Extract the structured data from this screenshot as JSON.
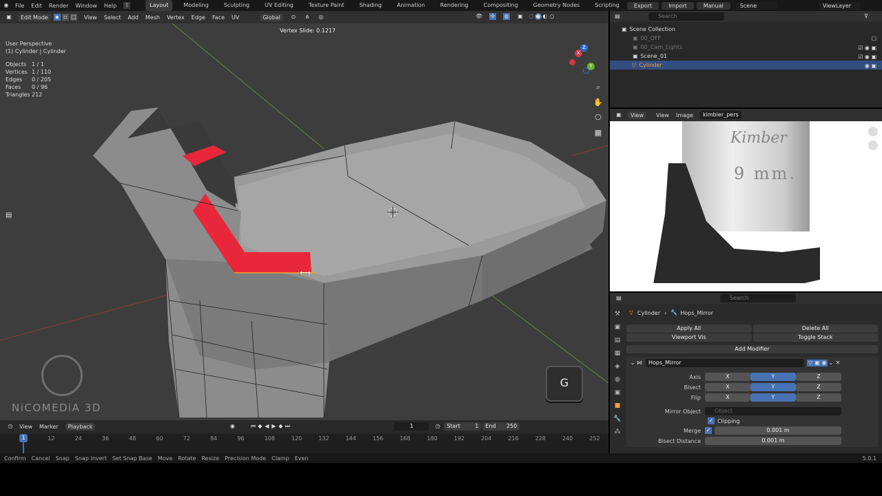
{
  "topbar": {
    "menus": [
      "File",
      "Edit",
      "Render",
      "Window",
      "Help"
    ],
    "workspaces": [
      "Layout",
      "Modeling",
      "Sculpting",
      "UV Editing",
      "Texture Paint",
      "Shading",
      "Animation",
      "Rendering",
      "Compositing",
      "Geometry Nodes",
      "Scripting"
    ],
    "active_workspace": "Layout",
    "export": "Export",
    "import": "Import",
    "manual": "Manual",
    "scene": "Scene",
    "view_layer": "ViewLayer"
  },
  "vp_header": {
    "mode": "Edit Mode",
    "menus": [
      "View",
      "Select",
      "Add",
      "Mesh",
      "Vertex",
      "Edge",
      "Face",
      "UV"
    ],
    "orientation": "Global"
  },
  "operator_text": "Vertex Slide: 0.1217",
  "overlay": {
    "perspective": "User Perspective",
    "object_name": "(1) Cylinder | Cylinder",
    "stats": [
      {
        "label": "Objects",
        "value": "1 / 1"
      },
      {
        "label": "Vertices",
        "value": "1 / 110"
      },
      {
        "label": "Edges",
        "value": "0 / 205"
      },
      {
        "label": "Faces",
        "value": "0 / 96"
      },
      {
        "label": "Triangles",
        "value": "212"
      }
    ]
  },
  "watermark": "NiCOMEDiA 3D",
  "key_badge": "G",
  "gizmo": {
    "x": "X",
    "y": "Y",
    "z": "Z"
  },
  "timeline": {
    "menus": [
      "View",
      "Marker",
      "Playback"
    ],
    "current_frame": "1",
    "start_label": "Start",
    "start": "1",
    "end_label": "End",
    "end": "250",
    "ticks": [
      "1",
      "12",
      "24",
      "36",
      "48",
      "60",
      "72",
      "84",
      "96",
      "108",
      "120",
      "132",
      "144",
      "156",
      "168",
      "180",
      "192",
      "204",
      "216",
      "228",
      "240",
      "252"
    ]
  },
  "statusbar": {
    "items": [
      "Confirm",
      "Cancel",
      "Snap",
      "Snap Invert",
      "Set Snap Base",
      "Move",
      "Rotate",
      "Resize",
      "Precision Mode",
      "Clamp",
      "Even"
    ],
    "version": "5.0.1"
  },
  "outliner": {
    "search_placeholder": "Search",
    "root": "Scene Collection",
    "items": [
      "00_OFF",
      "00_Cam_Lights",
      "Scene_01",
      "Cylinder"
    ]
  },
  "image_editor": {
    "menus": [
      "View",
      "View",
      "Image"
    ],
    "image_name": "kimbler_pers",
    "engrave1": "Kimber",
    "engrave2": "9 mm."
  },
  "props": {
    "search_placeholder": "Search",
    "breadcrumb_obj": "Cylinder",
    "breadcrumb_mod": "Hops_Mirror",
    "apply_all": "Apply All",
    "delete_all": "Delete All",
    "viewport_vis": "Viewport Vis",
    "toggle_stack": "Toggle Stack",
    "add_modifier": "Add Modifier",
    "modifier_name": "Hops_Mirror",
    "axis_label": "Axis",
    "bisect_label": "Bisect",
    "flip_label": "Flip",
    "xyz": [
      "X",
      "Y",
      "Z"
    ],
    "mirror_object_label": "Mirror Object",
    "object_placeholder": "Object",
    "clipping": "Clipping",
    "merge_label": "Merge",
    "merge_value": "0.001 m",
    "bisect_distance_label": "Bisect Distance",
    "bisect_distance_value": "0.001 m"
  },
  "colors": {
    "accent": "#4772b3",
    "selected_face": "#e8283a",
    "bg": "#3d3d3d"
  }
}
